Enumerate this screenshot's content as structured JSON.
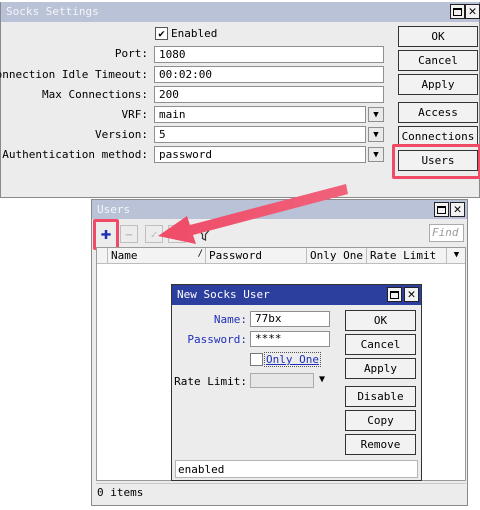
{
  "socks_window": {
    "title": "Socks Settings",
    "enabled_label": "Enabled",
    "enabled_checked": true,
    "port_label": "Port:",
    "port_value": "1080",
    "timeout_label": "Connection Idle Timeout:",
    "timeout_value": "00:02:00",
    "maxconn_label": "Max Connections:",
    "maxconn_value": "200",
    "vrf_label": "VRF:",
    "vrf_value": "main",
    "version_label": "Version:",
    "version_value": "5",
    "auth_label": "Authentication method:",
    "auth_value": "password",
    "buttons": {
      "ok": "OK",
      "cancel": "Cancel",
      "apply": "Apply",
      "access": "Access",
      "connections": "Connections",
      "users": "Users"
    }
  },
  "users_window": {
    "title": "Users",
    "find_placeholder": "Find",
    "columns": [
      "Name",
      "Password",
      "Only One",
      "Rate Limit"
    ],
    "status": "0 items"
  },
  "new_user_dialog": {
    "title": "New Socks User",
    "name_label": "Name:",
    "name_value": "77bx",
    "password_label": "Password:",
    "password_value": "****",
    "only_one_label": "Only One",
    "only_one_checked": false,
    "rate_limit_label": "Rate Limit:",
    "rate_limit_value": "",
    "buttons": {
      "ok": "OK",
      "cancel": "Cancel",
      "apply": "Apply",
      "disable": "Disable",
      "copy": "Copy",
      "remove": "Remove"
    },
    "status": "enabled"
  },
  "colors": {
    "highlight": "#ef4b67",
    "active_title": "#2c3e9e",
    "inactive_title": "#b9c2d6",
    "label_blue": "#1e2fb8"
  }
}
